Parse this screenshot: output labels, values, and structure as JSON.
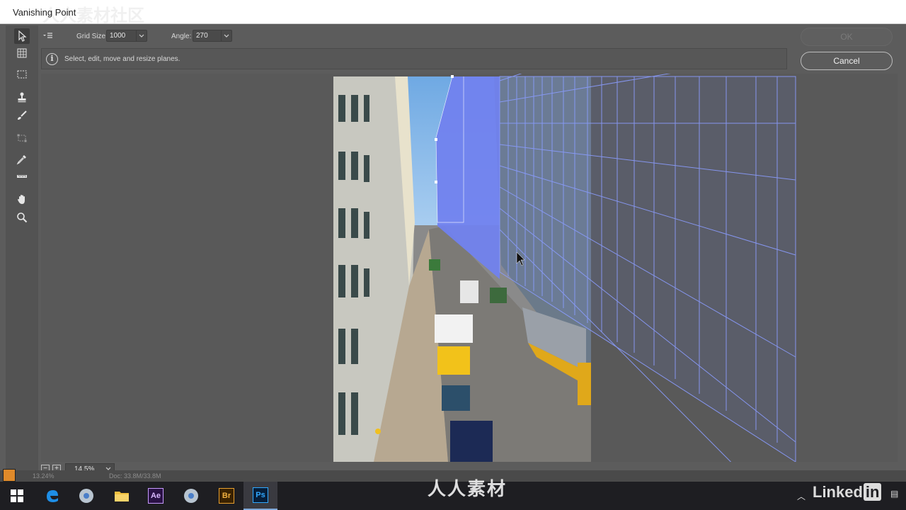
{
  "window": {
    "title": "Vanishing Point"
  },
  "options": {
    "grid_size_label": "Grid Size:",
    "grid_size_value": "1000",
    "angle_label": "Angle:",
    "angle_value": "270"
  },
  "info": {
    "message": "Select, edit, move and resize planes."
  },
  "buttons": {
    "ok": "OK",
    "cancel": "Cancel"
  },
  "zoom": {
    "value": "14.5%"
  },
  "status": {
    "zoom_level": "13.24%",
    "doc": "Doc: 33.8M/33.8M"
  },
  "toolbar": {
    "tools": [
      "edit-plane-tool",
      "create-plane-tool",
      "marquee-tool",
      "stamp-tool",
      "brush-tool",
      "transform-tool",
      "eyedropper-tool",
      "measure-tool",
      "hand-tool",
      "zoom-tool"
    ],
    "active": "edit-plane-tool"
  },
  "taskbar": {
    "apps": [
      "windows-start",
      "edge",
      "chrome",
      "file-explorer",
      "after-effects",
      "chrome-2",
      "bridge",
      "photoshop"
    ],
    "ae_label": "Ae",
    "br_label": "Br",
    "ps_label": "Ps",
    "active": "photoshop"
  },
  "watermark": {
    "center_text": "人人素材",
    "top_left_text": "人人素材社区",
    "brand": "Linked",
    "brand_in": "in"
  },
  "colors": {
    "plane_fill": "#7182ee",
    "grid_line": "#8a9cff",
    "accent": "#e08a2a"
  }
}
